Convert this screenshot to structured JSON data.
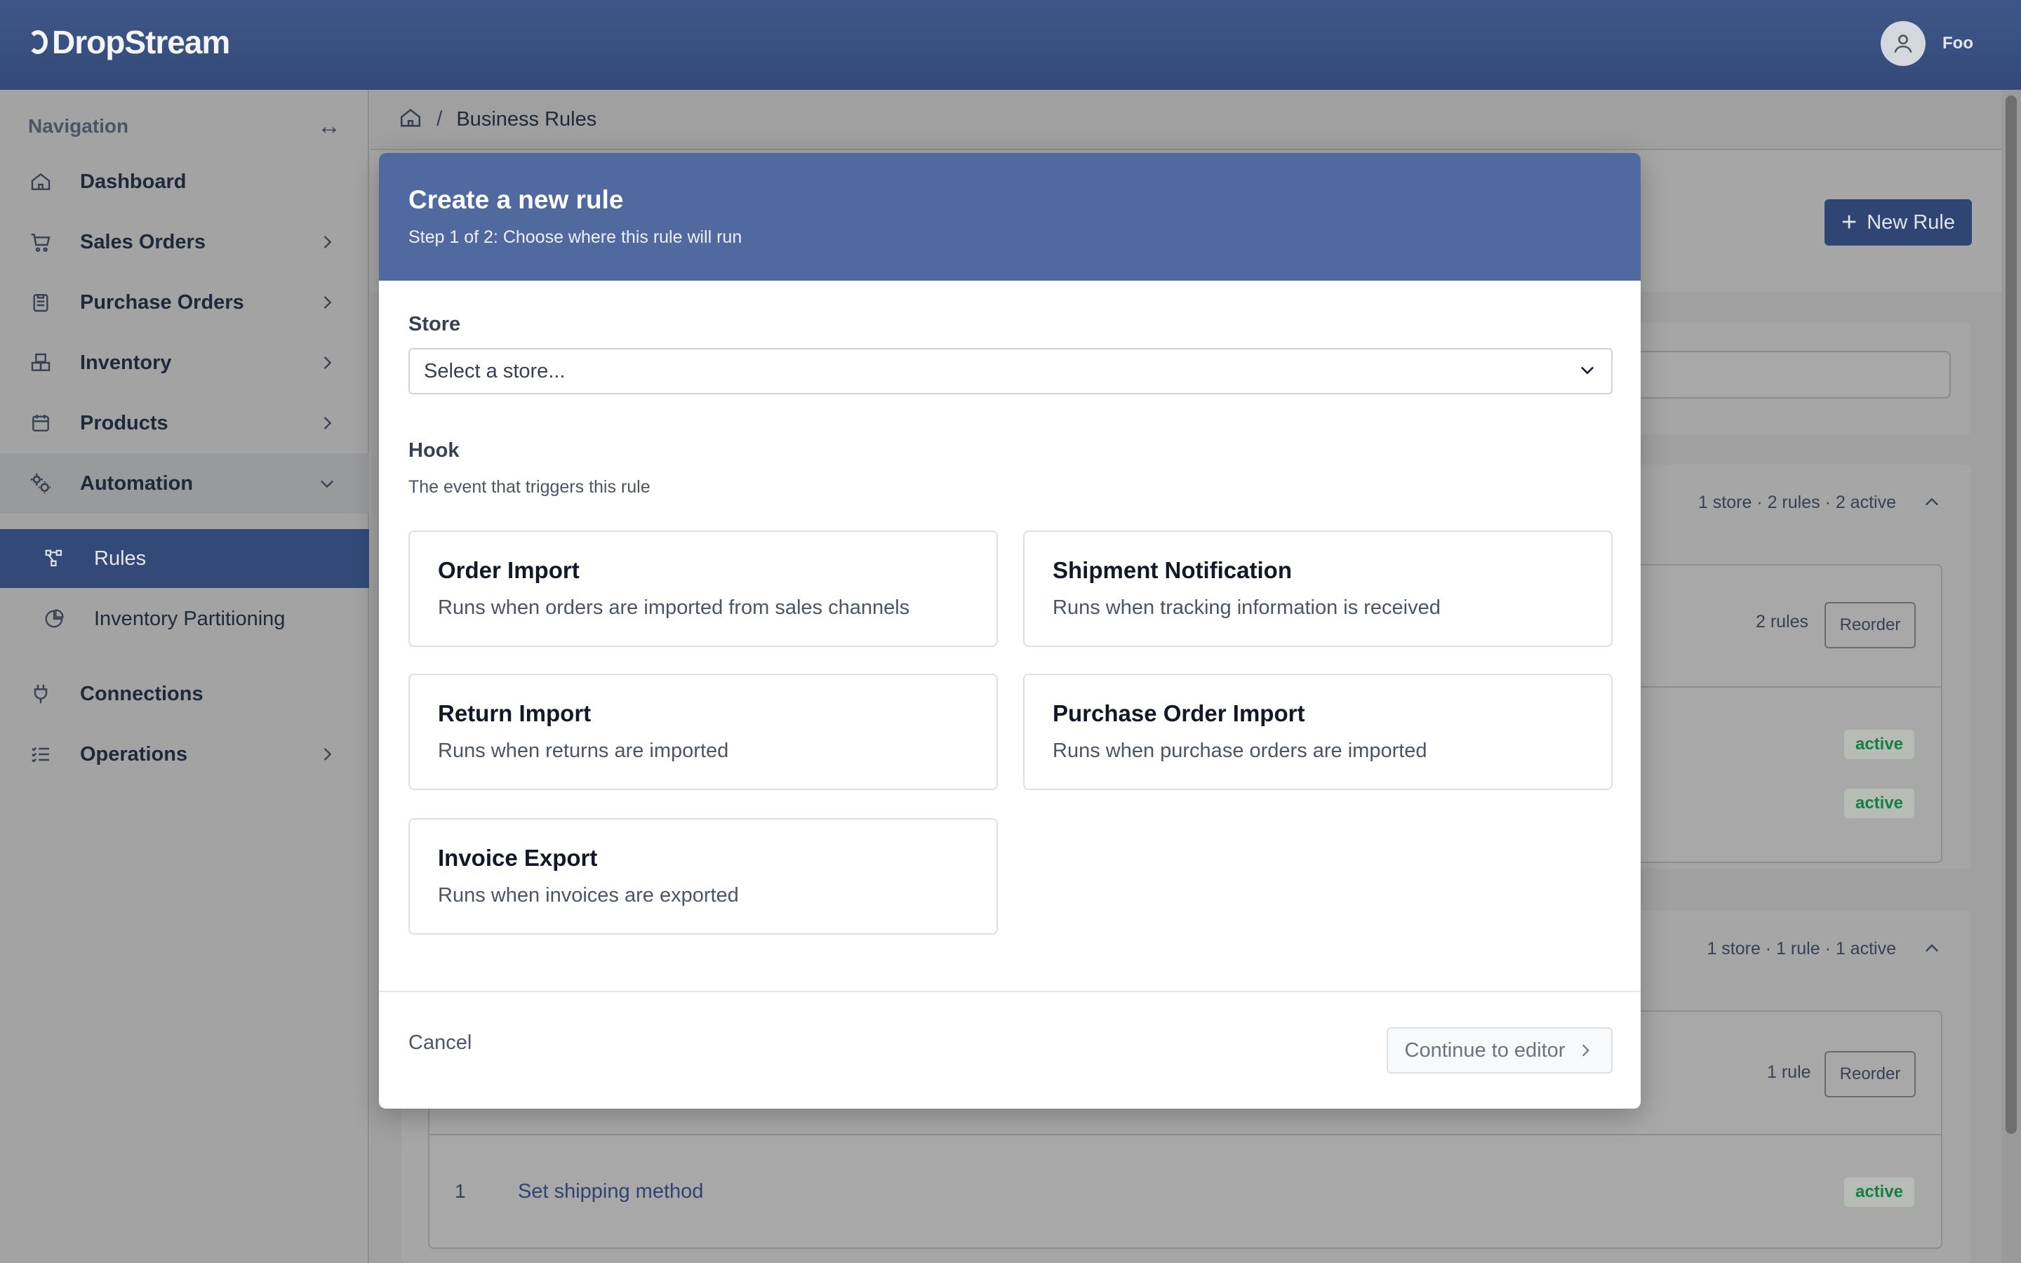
{
  "app": {
    "name": "DropStream"
  },
  "user": {
    "name": "Foo"
  },
  "sidebar": {
    "heading": "Navigation",
    "items": [
      {
        "label": "Dashboard"
      },
      {
        "label": "Sales Orders"
      },
      {
        "label": "Purchase Orders"
      },
      {
        "label": "Inventory"
      },
      {
        "label": "Products"
      },
      {
        "label": "Automation"
      },
      {
        "label": "Connections"
      },
      {
        "label": "Operations"
      }
    ],
    "automation_children": [
      {
        "label": "Rules"
      },
      {
        "label": "Inventory Partitioning"
      }
    ]
  },
  "breadcrumb": {
    "separator": "/",
    "current": "Business Rules"
  },
  "page": {
    "new_rule_label": "New Rule",
    "groups": [
      {
        "meta": "1 store · 2 rules · 2 active",
        "rules_count": "2 rules",
        "reorder_label": "Reorder",
        "badges": [
          "active",
          "active"
        ]
      },
      {
        "meta": "1 store · 1 rule · 1 active",
        "rules_count": "1 rule",
        "reorder_label": "Reorder",
        "rules": [
          {
            "num": "1",
            "name": "Set shipping method",
            "status": "active"
          }
        ]
      }
    ]
  },
  "modal": {
    "title": "Create a new rule",
    "subtitle": "Step 1 of 2: Choose where this rule will run",
    "store_label": "Store",
    "store_placeholder": "Select a store...",
    "hook_label": "Hook",
    "hook_help": "The event that triggers this rule",
    "hooks": [
      {
        "title": "Order Import",
        "desc": "Runs when orders are imported from sales channels"
      },
      {
        "title": "Shipment Notification",
        "desc": "Runs when tracking information is received"
      },
      {
        "title": "Return Import",
        "desc": "Runs when returns are imported"
      },
      {
        "title": "Purchase Order Import",
        "desc": "Runs when purchase orders are imported"
      },
      {
        "title": "Invoice Export",
        "desc": "Runs when invoices are exported"
      }
    ],
    "cancel_label": "Cancel",
    "continue_label": "Continue to editor"
  },
  "colors": {
    "brand": "#334a78",
    "modal_header": "#506aa0",
    "active_badge_text": "#15803d"
  }
}
